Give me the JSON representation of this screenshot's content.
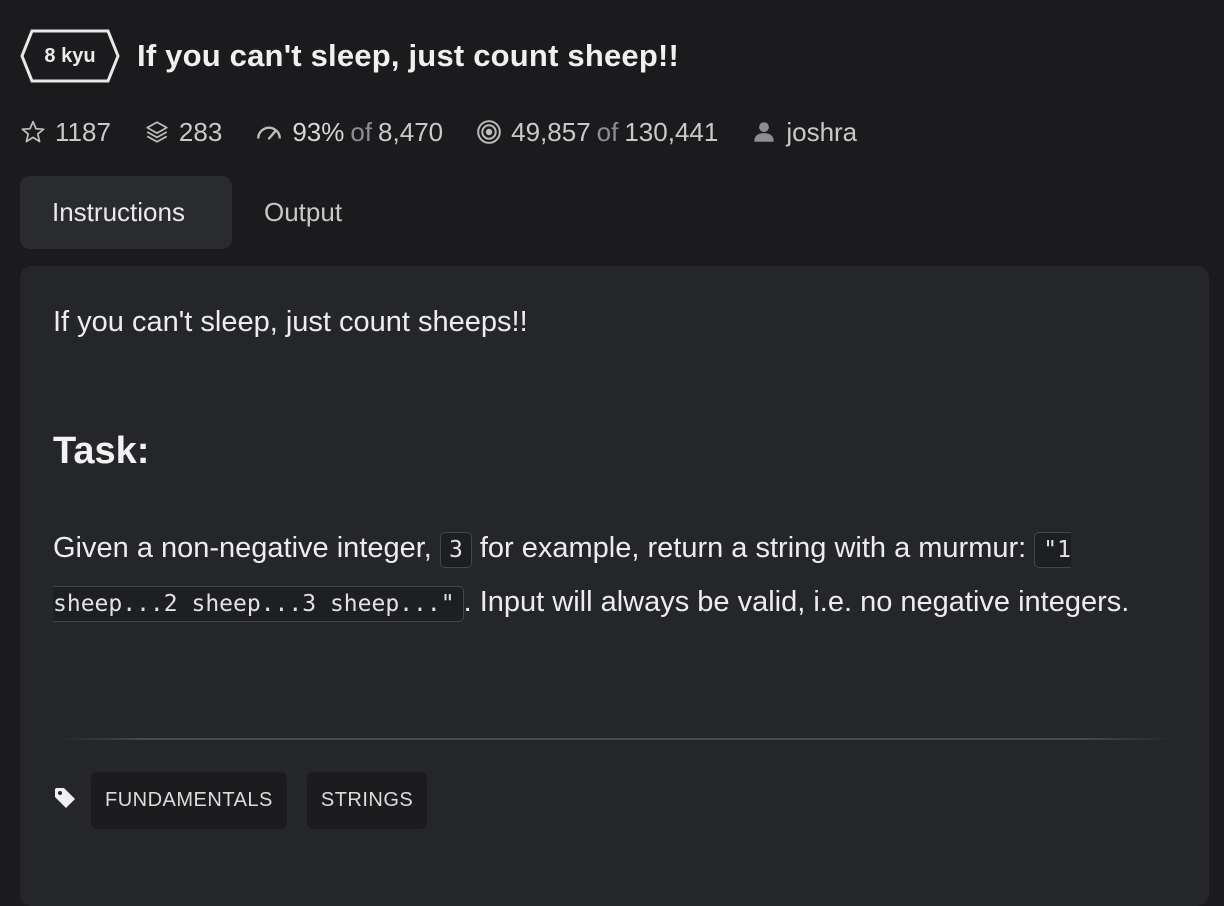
{
  "kata": {
    "rank": "8 kyu",
    "title": "If you can't sleep, just count sheep!!"
  },
  "stats": {
    "stars": "1187",
    "collections": "283",
    "satisfaction_percent": "93%",
    "satisfaction_of_label": "of",
    "satisfaction_votes": "8,470",
    "completed": "49,857",
    "completed_of_label": "of",
    "attempts": "130,441",
    "author": "joshra"
  },
  "tabs": [
    {
      "label": "Instructions",
      "active": true
    },
    {
      "label": "Output",
      "active": false
    }
  ],
  "instructions": {
    "intro": "If you can't sleep, just count sheeps!!",
    "heading": "Task:",
    "text_before_code1": "Given a non-negative integer, ",
    "code1": "3",
    "text_after_code1": " for example, return a string with a murmur: ",
    "code2": "\"1 sheep...2 sheep...3 sheep...\"",
    "text_after_code2": ". Input will always be valid, i.e. no negative integers."
  },
  "tags": [
    "FUNDAMENTALS",
    "STRINGS"
  ],
  "icons": {
    "star": "star-icon",
    "collections": "layers-icon",
    "satisfaction": "gauge-icon",
    "completed": "target-icon",
    "author": "user-icon",
    "tags": "tag-icon"
  }
}
